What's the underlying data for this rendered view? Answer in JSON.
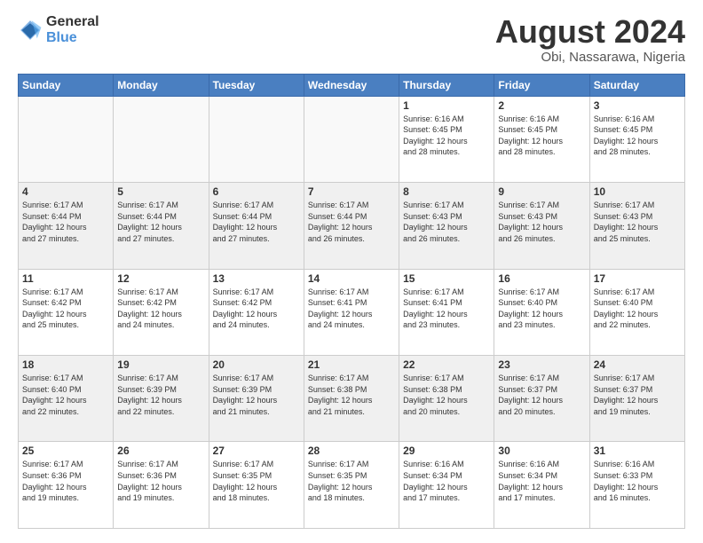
{
  "header": {
    "logo": {
      "general": "General",
      "blue": "Blue"
    },
    "title": "August 2024",
    "location": "Obi, Nassarawa, Nigeria"
  },
  "weekdays": [
    "Sunday",
    "Monday",
    "Tuesday",
    "Wednesday",
    "Thursday",
    "Friday",
    "Saturday"
  ],
  "weeks": [
    [
      {
        "day": "",
        "text": "",
        "empty": true
      },
      {
        "day": "",
        "text": "",
        "empty": true
      },
      {
        "day": "",
        "text": "",
        "empty": true
      },
      {
        "day": "",
        "text": "",
        "empty": true
      },
      {
        "day": "1",
        "text": "Sunrise: 6:16 AM\nSunset: 6:45 PM\nDaylight: 12 hours\nand 28 minutes.",
        "empty": false
      },
      {
        "day": "2",
        "text": "Sunrise: 6:16 AM\nSunset: 6:45 PM\nDaylight: 12 hours\nand 28 minutes.",
        "empty": false
      },
      {
        "day": "3",
        "text": "Sunrise: 6:16 AM\nSunset: 6:45 PM\nDaylight: 12 hours\nand 28 minutes.",
        "empty": false
      }
    ],
    [
      {
        "day": "4",
        "text": "Sunrise: 6:17 AM\nSunset: 6:44 PM\nDaylight: 12 hours\nand 27 minutes.",
        "empty": false
      },
      {
        "day": "5",
        "text": "Sunrise: 6:17 AM\nSunset: 6:44 PM\nDaylight: 12 hours\nand 27 minutes.",
        "empty": false
      },
      {
        "day": "6",
        "text": "Sunrise: 6:17 AM\nSunset: 6:44 PM\nDaylight: 12 hours\nand 27 minutes.",
        "empty": false
      },
      {
        "day": "7",
        "text": "Sunrise: 6:17 AM\nSunset: 6:44 PM\nDaylight: 12 hours\nand 26 minutes.",
        "empty": false
      },
      {
        "day": "8",
        "text": "Sunrise: 6:17 AM\nSunset: 6:43 PM\nDaylight: 12 hours\nand 26 minutes.",
        "empty": false
      },
      {
        "day": "9",
        "text": "Sunrise: 6:17 AM\nSunset: 6:43 PM\nDaylight: 12 hours\nand 26 minutes.",
        "empty": false
      },
      {
        "day": "10",
        "text": "Sunrise: 6:17 AM\nSunset: 6:43 PM\nDaylight: 12 hours\nand 25 minutes.",
        "empty": false
      }
    ],
    [
      {
        "day": "11",
        "text": "Sunrise: 6:17 AM\nSunset: 6:42 PM\nDaylight: 12 hours\nand 25 minutes.",
        "empty": false
      },
      {
        "day": "12",
        "text": "Sunrise: 6:17 AM\nSunset: 6:42 PM\nDaylight: 12 hours\nand 24 minutes.",
        "empty": false
      },
      {
        "day": "13",
        "text": "Sunrise: 6:17 AM\nSunset: 6:42 PM\nDaylight: 12 hours\nand 24 minutes.",
        "empty": false
      },
      {
        "day": "14",
        "text": "Sunrise: 6:17 AM\nSunset: 6:41 PM\nDaylight: 12 hours\nand 24 minutes.",
        "empty": false
      },
      {
        "day": "15",
        "text": "Sunrise: 6:17 AM\nSunset: 6:41 PM\nDaylight: 12 hours\nand 23 minutes.",
        "empty": false
      },
      {
        "day": "16",
        "text": "Sunrise: 6:17 AM\nSunset: 6:40 PM\nDaylight: 12 hours\nand 23 minutes.",
        "empty": false
      },
      {
        "day": "17",
        "text": "Sunrise: 6:17 AM\nSunset: 6:40 PM\nDaylight: 12 hours\nand 22 minutes.",
        "empty": false
      }
    ],
    [
      {
        "day": "18",
        "text": "Sunrise: 6:17 AM\nSunset: 6:40 PM\nDaylight: 12 hours\nand 22 minutes.",
        "empty": false
      },
      {
        "day": "19",
        "text": "Sunrise: 6:17 AM\nSunset: 6:39 PM\nDaylight: 12 hours\nand 22 minutes.",
        "empty": false
      },
      {
        "day": "20",
        "text": "Sunrise: 6:17 AM\nSunset: 6:39 PM\nDaylight: 12 hours\nand 21 minutes.",
        "empty": false
      },
      {
        "day": "21",
        "text": "Sunrise: 6:17 AM\nSunset: 6:38 PM\nDaylight: 12 hours\nand 21 minutes.",
        "empty": false
      },
      {
        "day": "22",
        "text": "Sunrise: 6:17 AM\nSunset: 6:38 PM\nDaylight: 12 hours\nand 20 minutes.",
        "empty": false
      },
      {
        "day": "23",
        "text": "Sunrise: 6:17 AM\nSunset: 6:37 PM\nDaylight: 12 hours\nand 20 minutes.",
        "empty": false
      },
      {
        "day": "24",
        "text": "Sunrise: 6:17 AM\nSunset: 6:37 PM\nDaylight: 12 hours\nand 19 minutes.",
        "empty": false
      }
    ],
    [
      {
        "day": "25",
        "text": "Sunrise: 6:17 AM\nSunset: 6:36 PM\nDaylight: 12 hours\nand 19 minutes.",
        "empty": false
      },
      {
        "day": "26",
        "text": "Sunrise: 6:17 AM\nSunset: 6:36 PM\nDaylight: 12 hours\nand 19 minutes.",
        "empty": false
      },
      {
        "day": "27",
        "text": "Sunrise: 6:17 AM\nSunset: 6:35 PM\nDaylight: 12 hours\nand 18 minutes.",
        "empty": false
      },
      {
        "day": "28",
        "text": "Sunrise: 6:17 AM\nSunset: 6:35 PM\nDaylight: 12 hours\nand 18 minutes.",
        "empty": false
      },
      {
        "day": "29",
        "text": "Sunrise: 6:16 AM\nSunset: 6:34 PM\nDaylight: 12 hours\nand 17 minutes.",
        "empty": false
      },
      {
        "day": "30",
        "text": "Sunrise: 6:16 AM\nSunset: 6:34 PM\nDaylight: 12 hours\nand 17 minutes.",
        "empty": false
      },
      {
        "day": "31",
        "text": "Sunrise: 6:16 AM\nSunset: 6:33 PM\nDaylight: 12 hours\nand 16 minutes.",
        "empty": false
      }
    ]
  ]
}
